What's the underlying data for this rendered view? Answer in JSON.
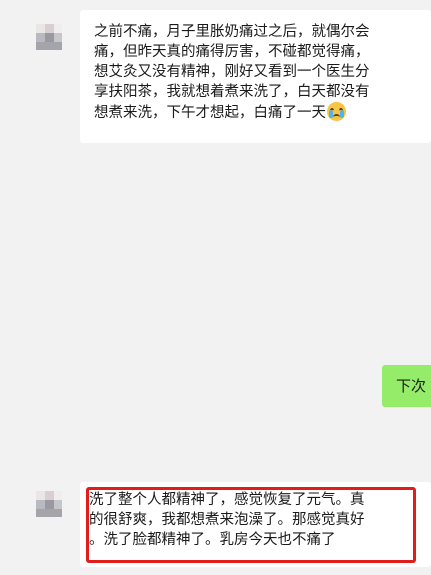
{
  "messages": [
    {
      "direction": "incoming",
      "lines": [
        "之前不痛，月子里胀奶痛过之后，就偶尔会",
        "痛，但昨天真的痛得厉害，不碰都觉得痛，",
        "想艾灸又没有精神，刚好又看到一个医生分",
        "享扶阳茶，我就想着煮来洗了，白天都没有",
        "想煮来洗，下午才想起，白痛了一天"
      ],
      "emoji": "crying-face"
    },
    {
      "direction": "outgoing",
      "text": "下次"
    },
    {
      "direction": "incoming",
      "lines": [
        "洗了整个人都精神了，感觉恢复了元气。真",
        "的很舒爽，我都想煮来泡澡了。那感觉真好",
        "。洗了脸都精神了。乳房今天也不痛了"
      ],
      "highlighted": true,
      "highlight_color": "#e21b1b"
    }
  ],
  "colors": {
    "background": "#f2f2f2",
    "incoming_bubble": "#ffffff",
    "outgoing_bubble": "#95ec69"
  }
}
